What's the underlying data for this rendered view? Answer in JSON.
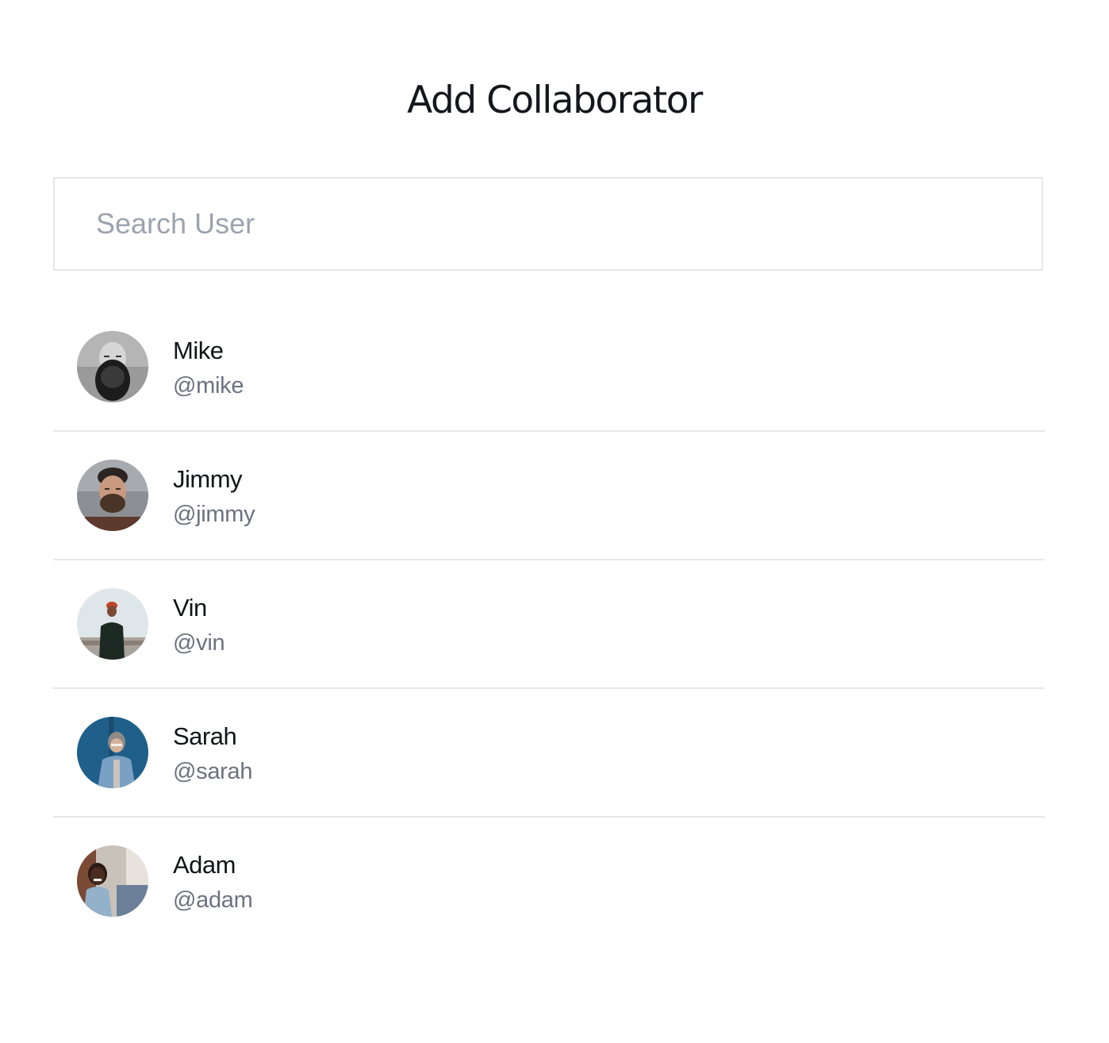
{
  "page": {
    "title": "Add Collaborator"
  },
  "search": {
    "placeholder": "Search User",
    "value": ""
  },
  "users": [
    {
      "name": "Mike",
      "handle": "@mike",
      "avatar": "avatar-photo-bald-bearded-man-bw"
    },
    {
      "name": "Jimmy",
      "handle": "@jimmy",
      "avatar": "avatar-photo-bearded-man"
    },
    {
      "name": "Vin",
      "handle": "@vin",
      "avatar": "avatar-photo-man-outdoor-red-beanie"
    },
    {
      "name": "Sarah",
      "handle": "@sarah",
      "avatar": "avatar-photo-woman-denim-jacket-blue-bg"
    },
    {
      "name": "Adam",
      "handle": "@adam",
      "avatar": "avatar-photo-man-city-street"
    }
  ],
  "colors": {
    "title": "#14171c",
    "name_text": "#111418",
    "handle_text": "#6b7280",
    "placeholder": "#9ca3af",
    "border": "#e5e7eb",
    "background": "#ffffff"
  }
}
